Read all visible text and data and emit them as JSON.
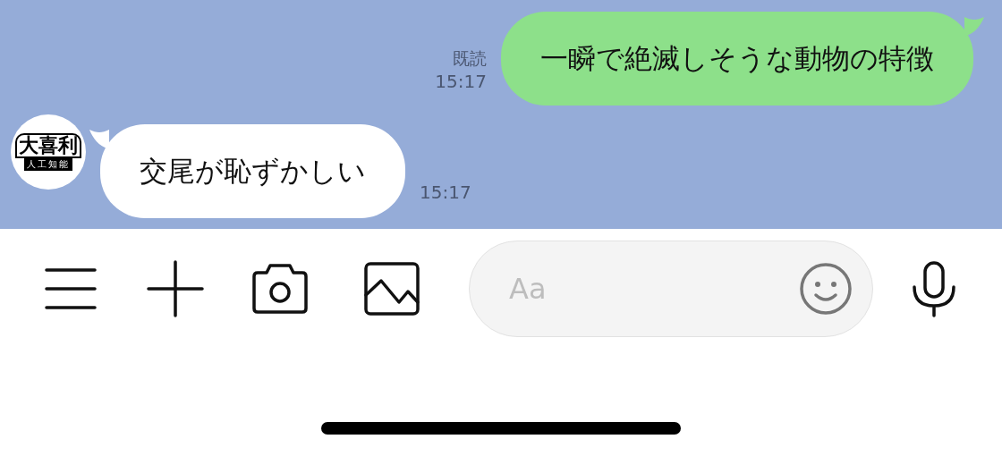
{
  "messages": [
    {
      "kind": "sent",
      "text": "一瞬で絶滅しそうな動物の特徴",
      "read_label": "既読",
      "time": "15:17"
    },
    {
      "kind": "received",
      "avatar": {
        "title": "大喜利",
        "subtitle": "人工知能"
      },
      "text": "交尾が恥ずかしい",
      "time": "15:17"
    }
  ],
  "composer": {
    "placeholder": "Aa"
  }
}
